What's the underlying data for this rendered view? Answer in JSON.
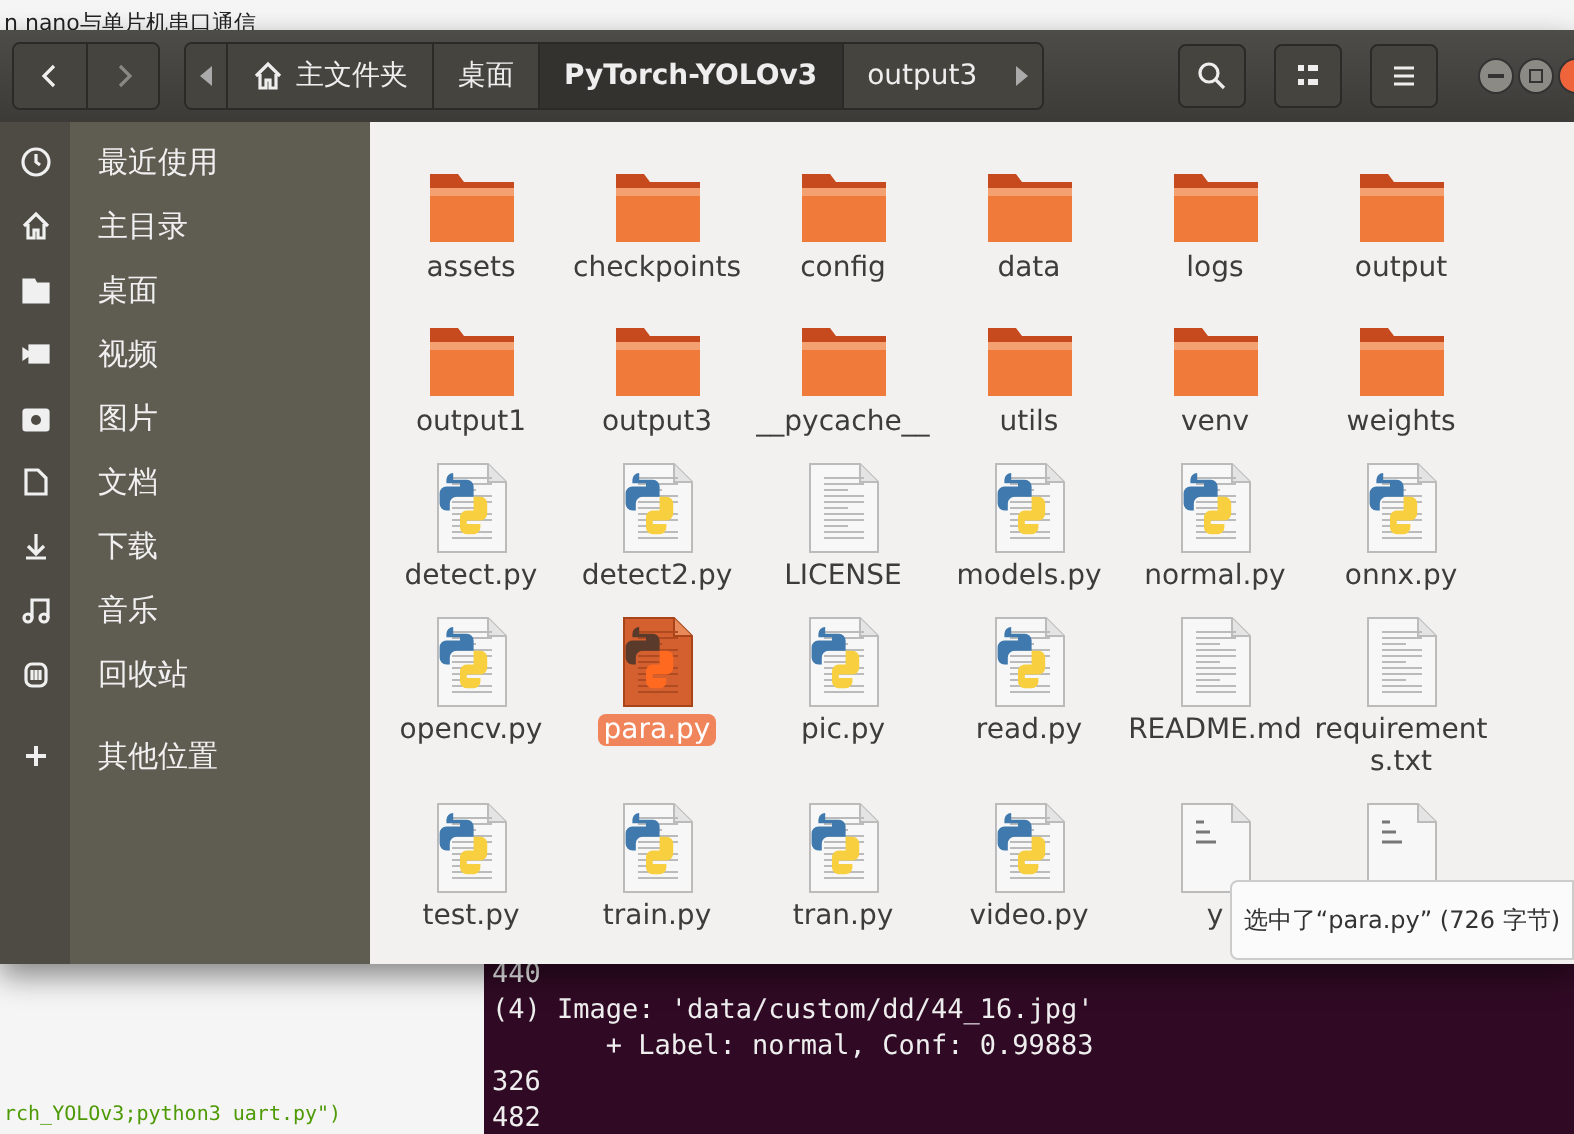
{
  "background_title": "n nano与单片机串口通信",
  "header": {
    "nav": {
      "back": {
        "disabled": false
      },
      "forward": {
        "disabled": true
      }
    },
    "path": [
      {
        "label": "主文件夹",
        "kind": "home",
        "selected": false
      },
      {
        "label": "桌面",
        "kind": "plain",
        "selected": false
      },
      {
        "label": "PyTorch-YOLOv3",
        "kind": "plain",
        "selected": true
      },
      {
        "label": "output3",
        "kind": "plain",
        "selected": false
      }
    ]
  },
  "sidebar": {
    "items": [
      {
        "label": "最近使用",
        "kind": "recent"
      },
      {
        "label": "主目录",
        "kind": "home"
      },
      {
        "label": "桌面",
        "kind": "folder"
      },
      {
        "label": "视频",
        "kind": "video"
      },
      {
        "label": "图片",
        "kind": "camera"
      },
      {
        "label": "文档",
        "kind": "document"
      },
      {
        "label": "下载",
        "kind": "download"
      },
      {
        "label": "音乐",
        "kind": "music"
      },
      {
        "label": "回收站",
        "kind": "trash"
      },
      {
        "label": "其他位置",
        "kind": "other"
      }
    ]
  },
  "files": [
    {
      "name": "assets",
      "kind": "folder",
      "selected": false
    },
    {
      "name": "checkpoints",
      "kind": "folder",
      "selected": false
    },
    {
      "name": "config",
      "kind": "folder",
      "selected": false
    },
    {
      "name": "data",
      "kind": "folder",
      "selected": false
    },
    {
      "name": "logs",
      "kind": "folder",
      "selected": false
    },
    {
      "name": "output",
      "kind": "folder",
      "selected": false
    },
    {
      "name": "output1",
      "kind": "folder",
      "selected": false
    },
    {
      "name": "output3",
      "kind": "folder",
      "selected": false
    },
    {
      "name": "__pycache__",
      "kind": "folder",
      "selected": false
    },
    {
      "name": "utils",
      "kind": "folder",
      "selected": false
    },
    {
      "name": "venv",
      "kind": "folder",
      "selected": false
    },
    {
      "name": "weights",
      "kind": "folder",
      "selected": false
    },
    {
      "name": "detect.py",
      "kind": "python",
      "selected": false
    },
    {
      "name": "detect2.py",
      "kind": "python",
      "selected": false
    },
    {
      "name": "LICENSE",
      "kind": "text",
      "selected": false
    },
    {
      "name": "models.py",
      "kind": "python",
      "selected": false
    },
    {
      "name": "normal.py",
      "kind": "python",
      "selected": false
    },
    {
      "name": "onnx.py",
      "kind": "python",
      "selected": false
    },
    {
      "name": "opencv.py",
      "kind": "python",
      "selected": false
    },
    {
      "name": "para.py",
      "kind": "python",
      "selected": true
    },
    {
      "name": "pic.py",
      "kind": "python",
      "selected": false
    },
    {
      "name": "read.py",
      "kind": "python",
      "selected": false
    },
    {
      "name": "README.md",
      "kind": "text",
      "selected": false
    },
    {
      "name": "requirements.txt",
      "kind": "text",
      "selected": false
    },
    {
      "name": "test.py",
      "kind": "python",
      "selected": false
    },
    {
      "name": "train.py",
      "kind": "python",
      "selected": false
    },
    {
      "name": "tran.py",
      "kind": "python",
      "selected": false
    },
    {
      "name": "video.py",
      "kind": "python",
      "selected": false
    },
    {
      "name": "y",
      "kind": "binary",
      "selected": false
    },
    {
      "kind": "binary",
      "selected": false
    }
  ],
  "status_tooltip": "选中了“para.py” (726 字节)",
  "editor_line": "rch_YOLOv3;python3 uart.py\")",
  "terminal_lines": [
    "440",
    "(4) Image: 'data/custom/dd/44_16.jpg'",
    "       + Label: normal, Conf: 0.99883",
    "326",
    "482"
  ]
}
